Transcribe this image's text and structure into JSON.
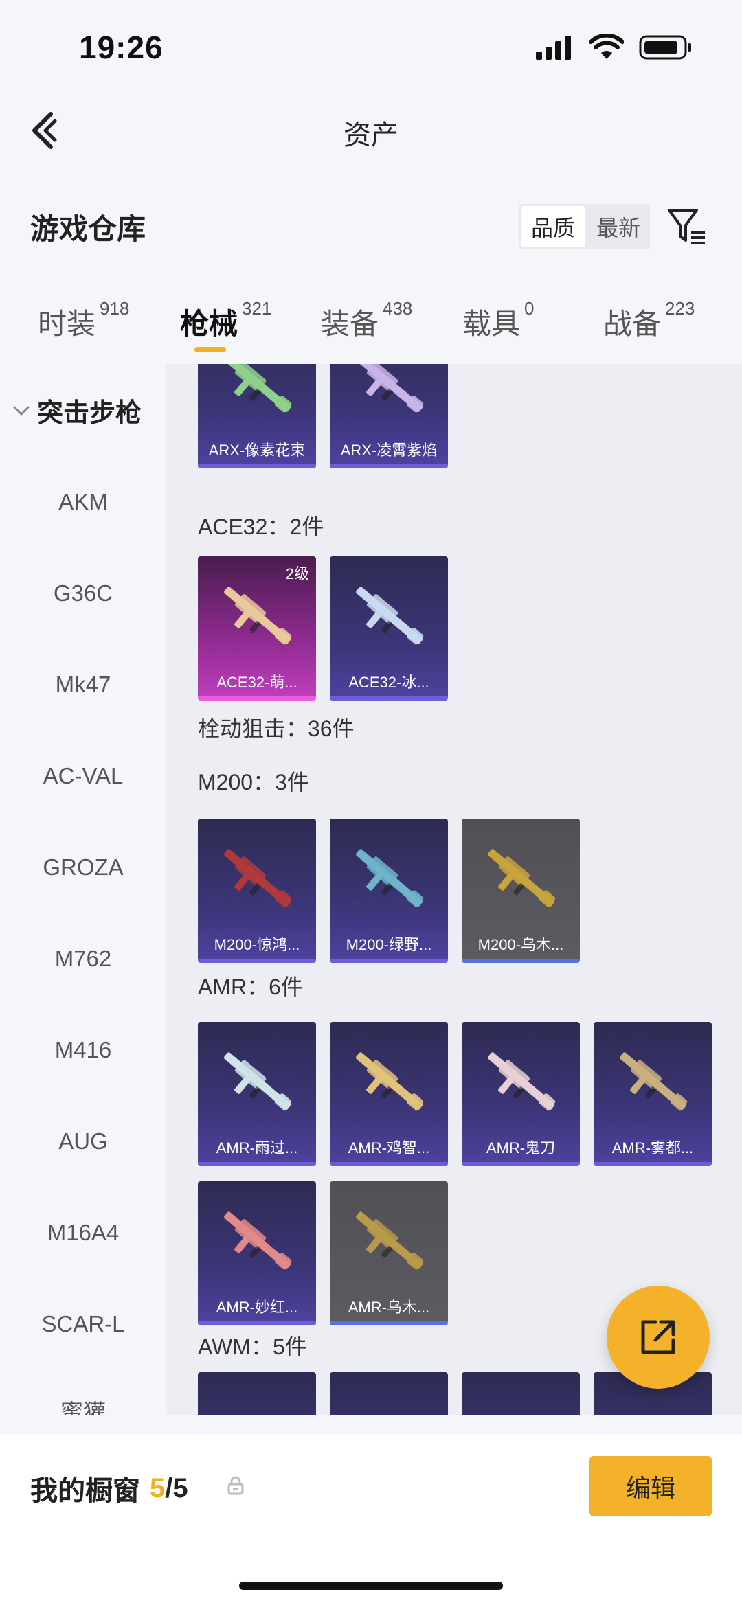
{
  "status": {
    "time": "19:26"
  },
  "header": {
    "title": "资产"
  },
  "section": {
    "title": "游戏仓库",
    "sort_options": [
      {
        "label": "品质",
        "active": true
      },
      {
        "label": "最新",
        "active": false
      }
    ]
  },
  "tabs": [
    {
      "label": "时装",
      "count": "918"
    },
    {
      "label": "枪械",
      "count": "321",
      "active": true
    },
    {
      "label": "装备",
      "count": "438"
    },
    {
      "label": "载具",
      "count": "0"
    },
    {
      "label": "战备",
      "count": "223"
    }
  ],
  "sidebar": {
    "group": "突击步枪",
    "items": [
      "AKM",
      "G36C",
      "Mk47",
      "AC-VAL",
      "GROZA",
      "M762",
      "M416",
      "AUG",
      "M16A4",
      "SCAR-L",
      "蜜獾"
    ]
  },
  "content": {
    "top_cards": [
      {
        "name": "ARX-像素花束",
        "style": "purple",
        "gun_color": "#8fd18a"
      },
      {
        "name": "ARX-凌霄紫焰",
        "style": "purple",
        "gun_color": "#c9b4e6"
      }
    ],
    "ace32_label": "ACE32：2件",
    "ace32_cards": [
      {
        "name": "ACE32-萌...",
        "style": "pink",
        "level": "2级",
        "gun_color": "#e9c99a"
      },
      {
        "name": "ACE32-冰...",
        "style": "purple",
        "gun_color": "#c8d9ef"
      }
    ],
    "bolt_label": "栓动狙击：36件",
    "m200_label": "M200：3件",
    "m200_cards": [
      {
        "name": "M200-惊鸿...",
        "style": "purple",
        "gun_color": "#b03a3a"
      },
      {
        "name": "M200-绿野...",
        "style": "purple",
        "gun_color": "#6fb4c8"
      },
      {
        "name": "M200-乌木...",
        "style": "gray",
        "gun_color": "#c8a43c"
      }
    ],
    "amr_label": "AMR：6件",
    "amr_cards": [
      {
        "name": "AMR-雨过...",
        "style": "purple",
        "gun_color": "#cfe3e8"
      },
      {
        "name": "AMR-鸡智...",
        "style": "purple",
        "gun_color": "#e0c27a"
      },
      {
        "name": "AMR-鬼刀",
        "style": "purple",
        "gun_color": "#e6d0d3"
      },
      {
        "name": "AMR-雾都...",
        "style": "purple",
        "gun_color": "#c9b07f"
      },
      {
        "name": "AMR-妙红...",
        "style": "purple",
        "gun_color": "#e08a8a"
      },
      {
        "name": "AMR-乌木...",
        "style": "gray",
        "gun_color": "#b89a4a"
      }
    ],
    "awm_label": "AWM：5件"
  },
  "bottom": {
    "showcase_label": "我的橱窗",
    "showcase_current": "5",
    "showcase_total": "/5",
    "edit_label": "编辑"
  }
}
